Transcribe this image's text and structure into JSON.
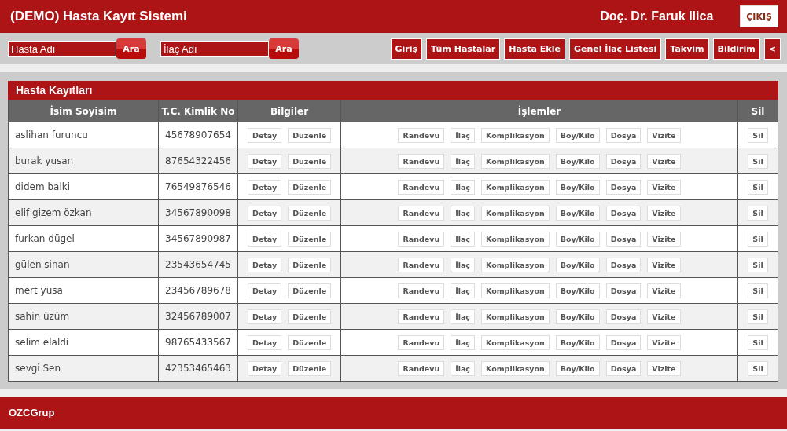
{
  "header": {
    "title": "(DEMO) Hasta Kayıt Sistemi",
    "user": "Doç. Dr. Faruk Ilica",
    "logout": "ÇIKIŞ"
  },
  "searches": [
    {
      "placeholder": "Hasta Adı",
      "button": "Ara"
    },
    {
      "placeholder": "İlaç Adı",
      "button": "Ara"
    }
  ],
  "nav": [
    "Giriş",
    "Tüm Hastalar",
    "Hasta Ekle",
    "Genel İlaç Listesi",
    "Takvim",
    "Bildirim",
    "<"
  ],
  "panel": {
    "title": "Hasta Kayıtları",
    "columns": [
      "İsim Soyisim",
      "T.C. Kimlik No",
      "Bilgiler",
      "İşlemler",
      "Sil"
    ],
    "rows": [
      {
        "name": "aslihan furuncu",
        "tc": "45678907654",
        "info": [
          "Detay",
          "Düzenle"
        ],
        "actions": [
          "Randevu",
          "İlaç",
          "Komplikasyon",
          "Boy/Kilo",
          "Dosya",
          "Vizite"
        ],
        "delete": "Sil"
      },
      {
        "name": "burak yusan",
        "tc": "87654322456",
        "info": [
          "Detay",
          "Düzenle"
        ],
        "actions": [
          "Randevu",
          "İlaç",
          "Komplikasyon",
          "Boy/Kilo",
          "Dosya",
          "Vizite"
        ],
        "delete": "Sil"
      },
      {
        "name": "didem balki",
        "tc": "76549876546",
        "info": [
          "Detay",
          "Düzenle"
        ],
        "actions": [
          "Randevu",
          "İlaç",
          "Komplikasyon",
          "Boy/Kilo",
          "Dosya",
          "Vizite"
        ],
        "delete": "Sil"
      },
      {
        "name": "elif gizem özkan",
        "tc": "34567890098",
        "info": [
          "Detay",
          "Düzenle"
        ],
        "actions": [
          "Randevu",
          "İlaç",
          "Komplikasyon",
          "Boy/Kilo",
          "Dosya",
          "Vizite"
        ],
        "delete": "Sil"
      },
      {
        "name": "furkan dügel",
        "tc": "34567890987",
        "info": [
          "Detay",
          "Düzenle"
        ],
        "actions": [
          "Randevu",
          "İlaç",
          "Komplikasyon",
          "Boy/Kilo",
          "Dosya",
          "Vizite"
        ],
        "delete": "Sil"
      },
      {
        "name": "gülen sinan",
        "tc": "23543654745",
        "info": [
          "Detay",
          "Düzenle"
        ],
        "actions": [
          "Randevu",
          "İlaç",
          "Komplikasyon",
          "Boy/Kilo",
          "Dosya",
          "Vizite"
        ],
        "delete": "Sil"
      },
      {
        "name": "mert yusa",
        "tc": "23456789678",
        "info": [
          "Detay",
          "Düzenle"
        ],
        "actions": [
          "Randevu",
          "İlaç",
          "Komplikasyon",
          "Boy/Kilo",
          "Dosya",
          "Vizite"
        ],
        "delete": "Sil"
      },
      {
        "name": "sahin üzüm",
        "tc": "32456789007",
        "info": [
          "Detay",
          "Düzenle"
        ],
        "actions": [
          "Randevu",
          "İlaç",
          "Komplikasyon",
          "Boy/Kilo",
          "Dosya",
          "Vizite"
        ],
        "delete": "Sil"
      },
      {
        "name": "selim elaldi",
        "tc": "98765433567",
        "info": [
          "Detay",
          "Düzenle"
        ],
        "actions": [
          "Randevu",
          "İlaç",
          "Komplikasyon",
          "Boy/Kilo",
          "Dosya",
          "Vizite"
        ],
        "delete": "Sil"
      },
      {
        "name": "sevgi Sen",
        "tc": "42353465463",
        "info": [
          "Detay",
          "Düzenle"
        ],
        "actions": [
          "Randevu",
          "İlaç",
          "Komplikasyon",
          "Boy/Kilo",
          "Dosya",
          "Vizite"
        ],
        "delete": "Sil"
      }
    ]
  },
  "footer": {
    "text": "OZCGrup"
  }
}
